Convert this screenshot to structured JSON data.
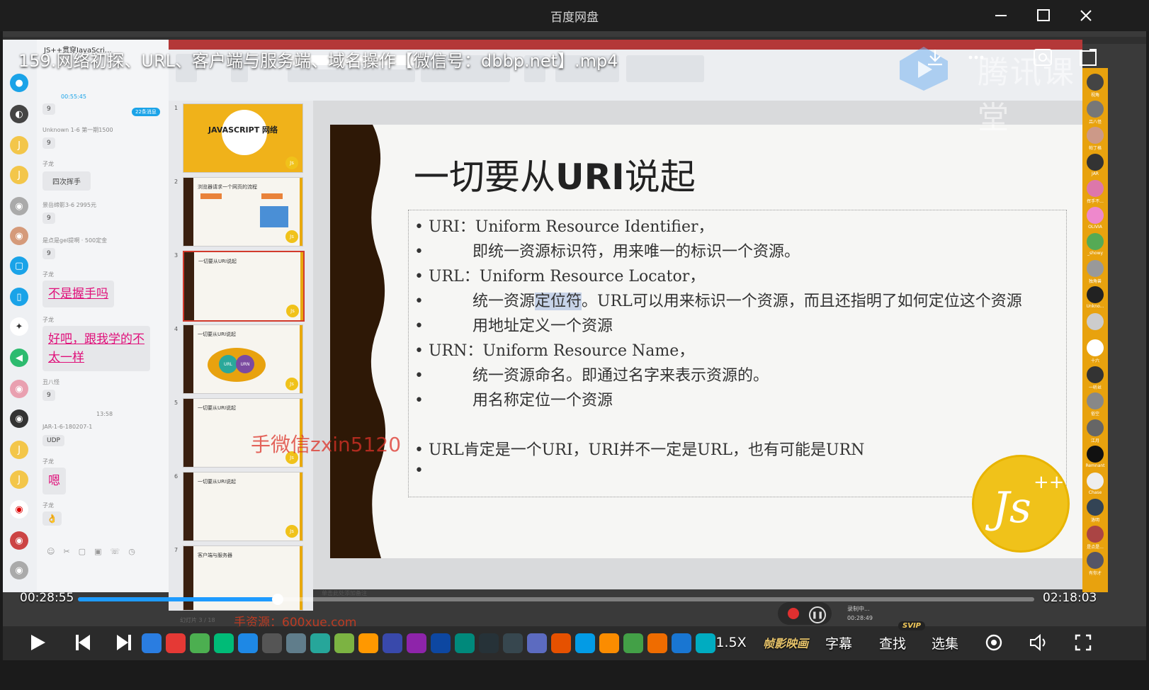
{
  "window": {
    "title": "百度网盘"
  },
  "video": {
    "title": "159.网络初探、URL、客户端与服务端、域名操作【微信号：dbbp.net】.mp4",
    "brand_watermark": "腾讯课堂"
  },
  "chat": {
    "header": "JS++贯穿JavaScri...",
    "top_time": "00:55:45",
    "badge": "22条消息",
    "messages": [
      {
        "name": "",
        "text": "9"
      },
      {
        "name": "Unknown 1-6 第一期1500",
        "text": "9"
      },
      {
        "name": "子龙",
        "text": "四次挥手"
      },
      {
        "name": "景岳缔影3-6 2995元",
        "text": "9"
      },
      {
        "name": "是点是gel提啊 · 500定金",
        "text": "9"
      },
      {
        "name": "子龙",
        "text": "不是握手吗"
      },
      {
        "name": "子龙",
        "text": "好吧，跟我学的不太一样"
      },
      {
        "name": "丑八怪",
        "text": "9"
      },
      {
        "name": "JAR-1-6-180207-1",
        "text": "UDP"
      },
      {
        "name": "子龙",
        "text": "嗯"
      },
      {
        "name": "子龙",
        "text": "👌"
      }
    ],
    "time_mark": "13:58"
  },
  "slide": {
    "title_prefix": "一切要从",
    "title_bold": "URI",
    "title_suffix": "说起",
    "bullets": [
      "URI：Uniform Resource Identifier，",
      "即统一资源标识符，用来唯一的标识一个资源。",
      "URL：Uniform Resource Locator，",
      "统一资源定位符。URL可以用来标识一个资源，而且还指明了如何定位这个资源",
      "用地址定义一个资源",
      "URN：Uniform Resource Name，",
      "统一资源命名。即通过名字来表示资源的。",
      "用名称定位一个资源",
      "URL肯定是一个URI，URI并不一定是URL，也有可能是URN"
    ],
    "highlight_text": "定位符",
    "notes_placeholder": "单击此处添加备注",
    "status": "幻灯片 3 / 18"
  },
  "thumbnails": [
    {
      "num": "1",
      "title": "JAVASCRIPT 网络"
    },
    {
      "num": "2",
      "title": "浏览器请求一个网页的流程"
    },
    {
      "num": "3",
      "title": "一切要从URI说起"
    },
    {
      "num": "4",
      "title": "一切要从URI说起"
    },
    {
      "num": "5",
      "title": "一切要从URI说起"
    },
    {
      "num": "6",
      "title": "一切要从URI说起"
    },
    {
      "num": "7",
      "title": "客户端与服务器"
    }
  ],
  "watermarks": {
    "center": "手微信zxin5120",
    "bottom": "手资源：600xue.com"
  },
  "avatars": [
    "视角",
    "吕八怪",
    "帕丁格",
    "JAR",
    "挥手不...",
    "OLIVIA",
    "_showy",
    "独角兽",
    "Unkno...",
    "",
    "十六",
    "一听丝",
    "俗空",
    "江月",
    "Remnant",
    "Chase",
    "洛明",
    "是点是...",
    "有你才"
  ],
  "player": {
    "current_time": "00:28:55",
    "total_time": "02:18:03",
    "progress": 0.209,
    "speed": "1.5X",
    "enhance": "帧影映画",
    "subtitle": "字幕",
    "find": "查找",
    "svip": "SVIP",
    "episodes": "选集",
    "rec_label": "录制中...",
    "rec_time": "00:28:49"
  },
  "colors": {
    "accent": "#1e9bff",
    "ppt_red": "#b43838",
    "js_yellow": "#f0c21a"
  }
}
